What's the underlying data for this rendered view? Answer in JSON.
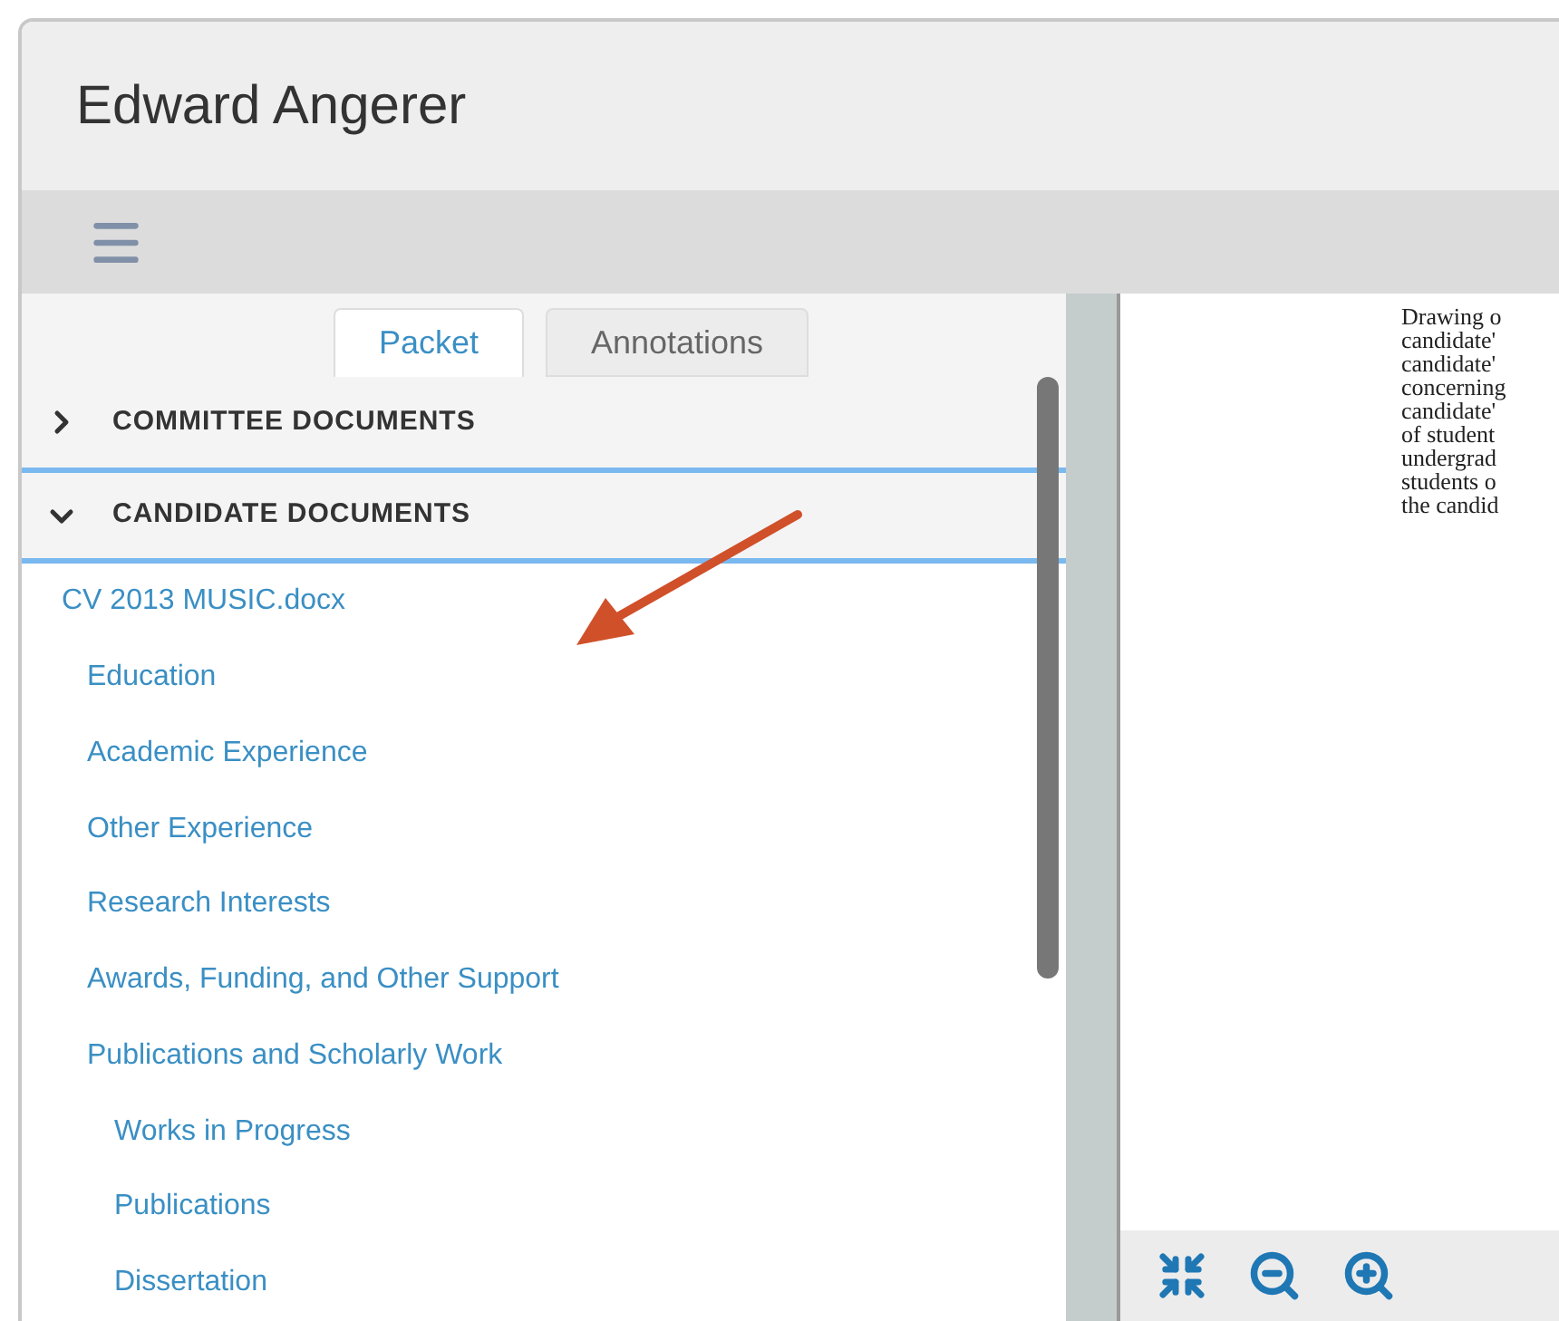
{
  "header": {
    "title": "Edward Angerer"
  },
  "tabs": [
    {
      "label": "Packet",
      "selected": true
    },
    {
      "label": "Annotations",
      "selected": false
    }
  ],
  "sections": [
    {
      "label": "COMMITTEE DOCUMENTS",
      "expanded": false
    },
    {
      "label": "CANDIDATE DOCUMENTS",
      "expanded": true,
      "children": [
        {
          "label": "CV 2013 MUSIC.docx",
          "children": [
            {
              "label": "Education"
            },
            {
              "label": "Academic Experience"
            },
            {
              "label": "Other Experience"
            },
            {
              "label": "Research Interests"
            },
            {
              "label": "Awards, Funding, and Other Support"
            },
            {
              "label": "Publications and Scholarly Work",
              "children": [
                {
                  "label": "Works in Progress"
                },
                {
                  "label": "Publications"
                },
                {
                  "label": "Dissertation"
                }
              ]
            }
          ]
        }
      ]
    }
  ],
  "document": {
    "lines": [
      "Drawing o",
      "candidate'",
      "candidate'",
      "concerning",
      "candidate'",
      "of student",
      "undergrad",
      "students o",
      "the candid"
    ]
  }
}
